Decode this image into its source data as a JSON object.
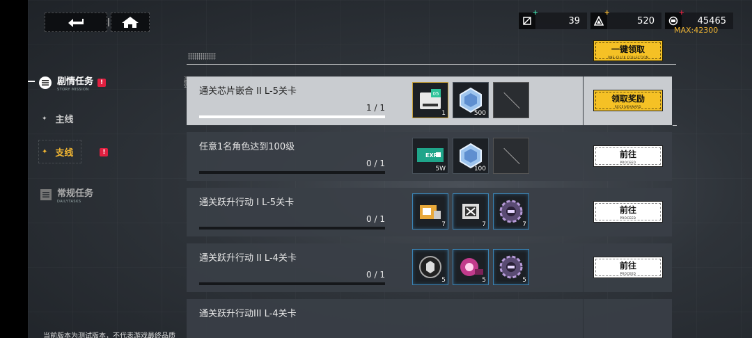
{
  "topbar": {
    "back_icon": "back-arrow-icon",
    "home_icon": "home-icon"
  },
  "resources": [
    {
      "icon": "stamina-icon",
      "value": "39",
      "plus_color": "#3fd9a8"
    },
    {
      "icon": "triangle-currency-icon",
      "value": "520",
      "plus_color": "#f2b632"
    },
    {
      "icon": "credit-icon",
      "value": "45465",
      "plus_color": "#e02040"
    }
  ],
  "max_label": "MAX:42300",
  "nav": {
    "story": {
      "label": "剧情任务",
      "sub": "STORY MISSION",
      "badge": "!"
    },
    "main": {
      "label": "主线"
    },
    "side": {
      "label": "支线",
      "badge": "!"
    },
    "daily": {
      "label": "常规任务",
      "sub": "DAILYTASKS"
    }
  },
  "collect_all": {
    "label": "一键领取",
    "sub": "ONE-CLICK COLLECTION"
  },
  "finish_tag": "FINISH",
  "tasks": [
    {
      "title": "通关芯片嵌合 II L-5关卡",
      "progress": "1 / 1",
      "progress_fraction": 1.0,
      "rewards": [
        {
          "icon": "chip-05-item-icon",
          "qty": "1",
          "style": "gold"
        },
        {
          "icon": "crystal-item-icon",
          "qty": "500",
          "style": "plain"
        },
        {
          "icon": "empty-slot-icon",
          "qty": "",
          "style": "empty"
        }
      ],
      "action": {
        "label": "领取奖励",
        "sub": "RECEIVEAWARD",
        "style": "gold"
      }
    },
    {
      "title": "任意1名角色达到100级",
      "progress": "0 / 1",
      "progress_fraction": 0.0,
      "rewards": [
        {
          "icon": "exp-ticket-icon",
          "qty": "5W",
          "style": "plain"
        },
        {
          "icon": "crystal-item-icon",
          "qty": "100",
          "style": "plain"
        },
        {
          "icon": "empty-slot-icon",
          "qty": "",
          "style": "empty"
        }
      ],
      "action": {
        "label": "前往",
        "sub": "PROCEED",
        "style": "white"
      }
    },
    {
      "title": "通关跃升行动 I L-5关卡",
      "progress": "0 / 1",
      "progress_fraction": 0.0,
      "rewards": [
        {
          "icon": "upgrade-kit-icon",
          "qty": "7",
          "style": "blue"
        },
        {
          "icon": "module-case-icon",
          "qty": "7",
          "style": "blue"
        },
        {
          "icon": "core-chip-icon",
          "qty": "7",
          "style": "blue"
        }
      ],
      "action": {
        "label": "前往",
        "sub": "PROCEED",
        "style": "white"
      }
    },
    {
      "title": "通关跃升行动 II L-4关卡",
      "progress": "0 / 1",
      "progress_fraction": 0.0,
      "rewards": [
        {
          "icon": "badge-chip-icon",
          "qty": "5",
          "style": "blue"
        },
        {
          "icon": "pink-core-icon",
          "qty": "5",
          "style": "blue"
        },
        {
          "icon": "core-chip-icon",
          "qty": "5",
          "style": "blue"
        }
      ],
      "action": {
        "label": "前往",
        "sub": "PROCEED",
        "style": "white"
      }
    },
    {
      "title": "通关跃升行动III L-4关卡",
      "progress": "",
      "progress_fraction": 0.0,
      "rewards": [],
      "action": {
        "label": "",
        "sub": "",
        "style": "white"
      }
    }
  ],
  "footnote": "当前版本为测试版本，不代表游戏最终品质"
}
